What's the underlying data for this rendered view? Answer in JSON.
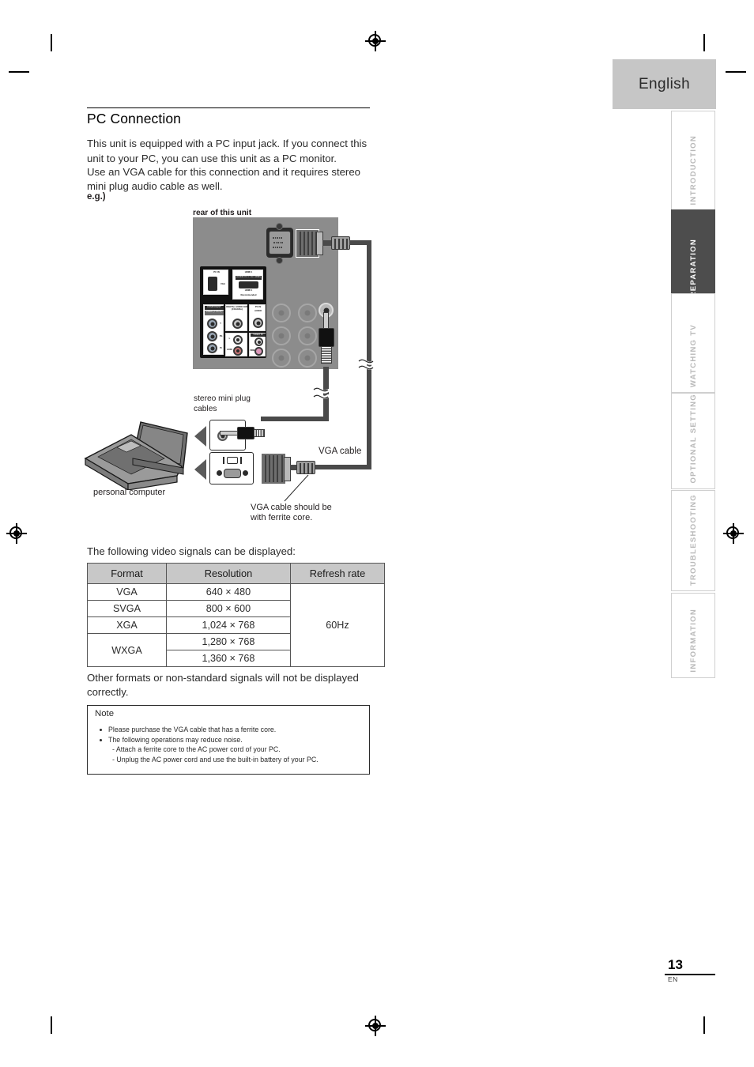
{
  "document": {
    "language_tab": "English",
    "page_number": "13",
    "page_language_code": "EN"
  },
  "sidebar": {
    "tabs": [
      {
        "label": "INTRODUCTION",
        "active": false
      },
      {
        "label": "PREPARATION",
        "active": true
      },
      {
        "label": "WATCHING TV",
        "active": false
      },
      {
        "label": "OPTIONAL SETTING",
        "active": false
      },
      {
        "label": "TROUBLESHOOTING",
        "active": false
      },
      {
        "label": "INFORMATION",
        "active": false
      }
    ]
  },
  "section": {
    "heading": "PC Connection",
    "paragraph_line1": "This unit is equipped with a PC input jack. If you connect this",
    "paragraph_line2": "unit to your PC, you can use this unit as a PC monitor.",
    "paragraph_line3": "Use an VGA cable for this connection and it requires stereo",
    "paragraph_line4": "mini plug audio cable as well.",
    "example_label": "e.g.)"
  },
  "figure": {
    "caption_rear": "rear of this unit",
    "caption_stereo_line1": "stereo mini plug",
    "caption_stereo_line2": "cables",
    "caption_vga_cable": "VGA cable",
    "caption_personal_computer": "personal computer",
    "caption_ferrite_line1": "VGA cable should be",
    "caption_ferrite_line2": "with ferrite core.",
    "panel_labels": {
      "pc_in_video": "PC IN",
      "pc_in_video_sub": "VGA",
      "hdmi": "HDMI 1",
      "hdmi_sub": "(AUDIO IN 4 1 for HDMI)",
      "hdmi_note": "Recommended",
      "component": "COMPONENT",
      "component_sub": "VIDEO (Y Pb Pr)",
      "digital_audio_out": "DIGITAL AUDIO OUT (COAXIAL)",
      "pc_in_audio": "PC IN",
      "pc_in_audio_sub": "AUDIO",
      "video_in": "VIDEO IN",
      "ch_y": "Y",
      "ch_pb": "Pb",
      "ch_pr": "Pr",
      "ch_l": "L",
      "ch_r": "R",
      "ch_audio": "AUDIO",
      "ch_video": "VIDEO"
    }
  },
  "signals": {
    "intro": "The following video signals can be displayed:",
    "columns": [
      "Format",
      "Resolution",
      "Refresh rate"
    ],
    "rows": [
      {
        "format": "VGA",
        "resolution": "640 ×  480"
      },
      {
        "format": "SVGA",
        "resolution": "800 ×  600"
      },
      {
        "format": "XGA",
        "resolution": "1,024 ×  768"
      },
      {
        "format": "WXGA",
        "resolution": "1,280 ×  768"
      },
      {
        "format": "",
        "resolution": "1,360 ×  768"
      }
    ],
    "refresh_rate": "60Hz",
    "footnote_line1": "Other formats or non-standard signals will not be displayed",
    "footnote_line2": "correctly."
  },
  "note": {
    "title": "Note",
    "items": [
      {
        "kind": "bullet",
        "text": "Please purchase the VGA cable that has a ferrite core."
      },
      {
        "kind": "bullet",
        "text": "The following operations may reduce noise."
      },
      {
        "kind": "sub",
        "text": "- Attach a ferrite core to the AC power cord of your PC."
      },
      {
        "kind": "sub",
        "text": "- Unplug the AC power cord and use the built-in battery of your PC."
      }
    ]
  },
  "colors": {
    "active_tab": "#4d4d4d",
    "language_tab": "#c6c6c6",
    "table_header": "#c8c8c8",
    "figure_background": "#8c8c8c"
  }
}
